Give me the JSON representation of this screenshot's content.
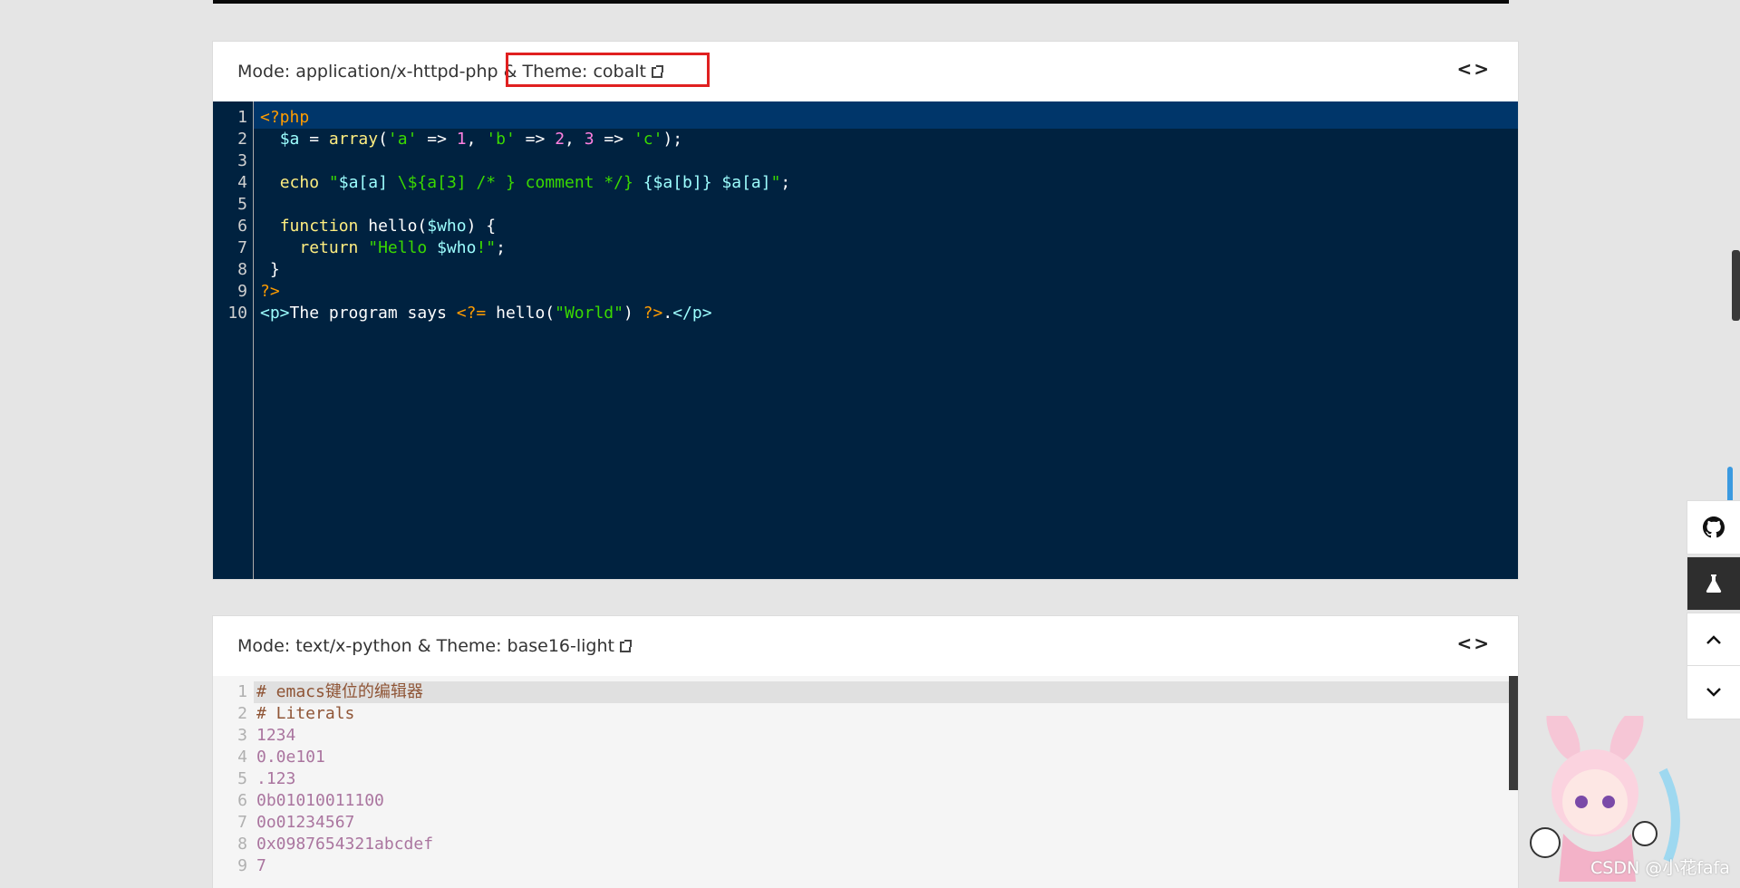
{
  "panel1": {
    "mode_label": "Mode: application/x-httpd-php & ",
    "theme_label": "Theme: cobalt",
    "toggle": "<>",
    "lines": [
      {
        "n": "1",
        "t": [
          {
            "c": "tg",
            "s": "<?php"
          }
        ]
      },
      {
        "n": "2",
        "t": [
          {
            "c": "pl",
            "s": "  "
          },
          {
            "c": "vr",
            "s": "$a"
          },
          {
            "c": "pl",
            "s": " = "
          },
          {
            "c": "kw",
            "s": "array"
          },
          {
            "c": "pl",
            "s": "("
          },
          {
            "c": "st",
            "s": "'a'"
          },
          {
            "c": "pl",
            "s": " => "
          },
          {
            "c": "nm",
            "s": "1"
          },
          {
            "c": "pl",
            "s": ", "
          },
          {
            "c": "st",
            "s": "'b'"
          },
          {
            "c": "pl",
            "s": " => "
          },
          {
            "c": "nm",
            "s": "2"
          },
          {
            "c": "pl",
            "s": ", "
          },
          {
            "c": "nm",
            "s": "3"
          },
          {
            "c": "pl",
            "s": " => "
          },
          {
            "c": "st",
            "s": "'c'"
          },
          {
            "c": "pl",
            "s": ");"
          }
        ]
      },
      {
        "n": "3",
        "t": [
          {
            "c": "pl",
            "s": ""
          }
        ]
      },
      {
        "n": "4",
        "t": [
          {
            "c": "pl",
            "s": "  "
          },
          {
            "c": "kw",
            "s": "echo"
          },
          {
            "c": "pl",
            "s": " "
          },
          {
            "c": "st",
            "s": "\""
          },
          {
            "c": "vr",
            "s": "$a[a]"
          },
          {
            "c": "st",
            "s": " \\${a[3] /* } comment */} "
          },
          {
            "c": "vr",
            "s": "{$a[b]}"
          },
          {
            "c": "st",
            "s": " "
          },
          {
            "c": "vr",
            "s": "$a[a]"
          },
          {
            "c": "st",
            "s": "\""
          },
          {
            "c": "pl",
            "s": ";"
          }
        ]
      },
      {
        "n": "5",
        "t": [
          {
            "c": "pl",
            "s": ""
          }
        ]
      },
      {
        "n": "6",
        "t": [
          {
            "c": "pl",
            "s": "  "
          },
          {
            "c": "kw",
            "s": "function"
          },
          {
            "c": "pl",
            "s": " hello("
          },
          {
            "c": "vr",
            "s": "$who"
          },
          {
            "c": "pl",
            "s": ") {"
          }
        ]
      },
      {
        "n": "7",
        "t": [
          {
            "c": "pl",
            "s": "    "
          },
          {
            "c": "kw",
            "s": "return"
          },
          {
            "c": "pl",
            "s": " "
          },
          {
            "c": "st",
            "s": "\"Hello "
          },
          {
            "c": "vr",
            "s": "$who"
          },
          {
            "c": "st",
            "s": "!\""
          },
          {
            "c": "pl",
            "s": ";"
          }
        ]
      },
      {
        "n": "8",
        "t": [
          {
            "c": "pl",
            "s": " }"
          }
        ]
      },
      {
        "n": "9",
        "t": [
          {
            "c": "tg",
            "s": "?>"
          }
        ]
      },
      {
        "n": "10",
        "t": [
          {
            "c": "vr",
            "s": "<p>"
          },
          {
            "c": "pl",
            "s": "The program says "
          },
          {
            "c": "tg",
            "s": "<?="
          },
          {
            "c": "pl",
            "s": " hello("
          },
          {
            "c": "st",
            "s": "\"World\""
          },
          {
            "c": "pl",
            "s": ") "
          },
          {
            "c": "tg",
            "s": "?>"
          },
          {
            "c": "pl",
            "s": "."
          },
          {
            "c": "vr",
            "s": "</p>"
          }
        ]
      }
    ]
  },
  "panel2": {
    "mode_label": "Mode: text/x-python & Theme: base16-light",
    "toggle": "<>",
    "lines": [
      {
        "n": "1",
        "t": [
          {
            "c": "cm",
            "s": "# emacs键位的编辑器"
          }
        ]
      },
      {
        "n": "2",
        "t": [
          {
            "c": "cm",
            "s": "# Literals"
          }
        ]
      },
      {
        "n": "3",
        "t": [
          {
            "c": "n16",
            "s": "1234"
          }
        ]
      },
      {
        "n": "4",
        "t": [
          {
            "c": "n16",
            "s": "0.0e101"
          }
        ]
      },
      {
        "n": "5",
        "t": [
          {
            "c": "n16",
            "s": ".123"
          }
        ]
      },
      {
        "n": "6",
        "t": [
          {
            "c": "n16",
            "s": "0b01010011100"
          }
        ]
      },
      {
        "n": "7",
        "t": [
          {
            "c": "n16",
            "s": "0o01234567"
          }
        ]
      },
      {
        "n": "8",
        "t": [
          {
            "c": "n16",
            "s": "0x0987654321abcdef"
          }
        ]
      },
      {
        "n": "9",
        "t": [
          {
            "c": "n16",
            "s": "7"
          }
        ]
      }
    ]
  },
  "sidebar": {
    "icons": [
      "github-icon",
      "flask-icon",
      "chevron-up-icon",
      "chevron-down-icon"
    ]
  },
  "watermark": "CSDN @小花fafa",
  "colors": {
    "cobalt_bg": "#002240",
    "cobalt_active_line": "#00366a",
    "base16_bg": "#f5f5f5",
    "highlight_box": "#e02020"
  }
}
